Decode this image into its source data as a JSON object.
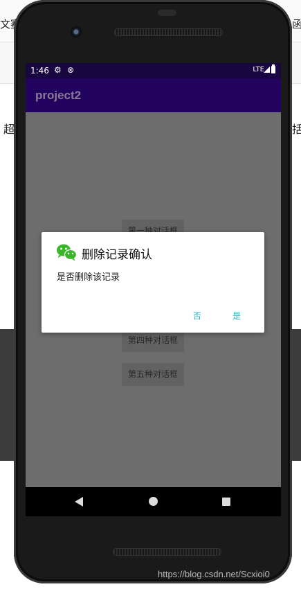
{
  "background_page": {
    "left_top_text": "文赛",
    "right_top_text": "函",
    "left_mid_text": "超",
    "right_mid_text": "括"
  },
  "status_bar": {
    "time": "1:46",
    "network": "LTE"
  },
  "app": {
    "title": "project2"
  },
  "buttons": [
    {
      "label": "第一种对话框"
    },
    {
      "label": "第四种对话框"
    },
    {
      "label": "第五种对话框"
    }
  ],
  "dialog": {
    "icon": "wechat-icon",
    "title": "删除记录确认",
    "message": "是否删除该记录",
    "negative_label": "否",
    "positive_label": "是",
    "accent_color": "#2ab4c4",
    "icon_color": "#3bb62a"
  },
  "watermark": "https://blog.csdn.net/Scxioi0"
}
